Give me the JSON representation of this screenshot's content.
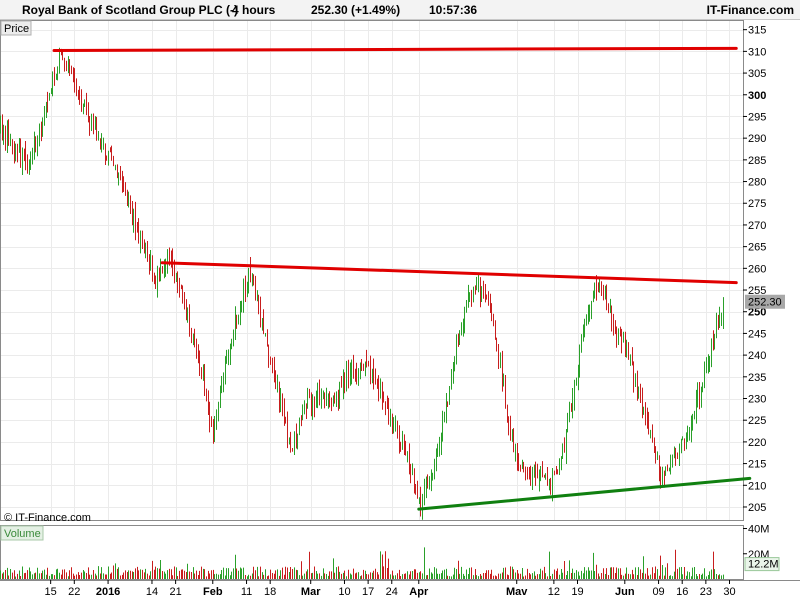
{
  "header": {
    "instrument": "Royal Bank of Scotland Group PLC (-)",
    "interval": "4 hours",
    "price_change": "252.30 (+1.49%)",
    "time": "10:57:36",
    "brand": "IT-Finance.com"
  },
  "panels": {
    "price_label": "Price",
    "volume_label": "Volume",
    "watermark": "© IT-Finance.com"
  },
  "colors": {
    "up": "#2aa02a",
    "down": "#c81e1e",
    "resistance": "#e00000",
    "support": "#108010",
    "last_price_bg": "#a8a8a8",
    "volume_label_bg": "#e4f0e4"
  },
  "chart_data": {
    "type": "candlestick",
    "price_axis": {
      "ylim": [
        202,
        317
      ],
      "ticks": [
        205,
        210,
        215,
        220,
        225,
        230,
        235,
        240,
        245,
        250,
        255,
        260,
        265,
        270,
        275,
        280,
        285,
        290,
        295,
        300,
        305,
        310,
        315
      ],
      "bold_ticks": [
        250,
        300
      ]
    },
    "volume_axis": {
      "ylim": [
        0,
        42
      ],
      "ticks": [
        {
          "value": 40,
          "label": "40M"
        },
        {
          "value": 20,
          "label": "20M"
        }
      ],
      "last_volume": {
        "value": 12.2,
        "label": "12.2M"
      }
    },
    "x_axis": {
      "ticks": [
        {
          "label": "15",
          "t": 15
        },
        {
          "label": "22",
          "t": 22
        },
        {
          "label": "2016",
          "t": 32,
          "bold": true
        },
        {
          "label": "14",
          "t": 45
        },
        {
          "label": "21",
          "t": 52
        },
        {
          "label": "Feb",
          "t": 63,
          "bold": true
        },
        {
          "label": "11",
          "t": 73
        },
        {
          "label": "18",
          "t": 80
        },
        {
          "label": "Mar",
          "t": 92,
          "bold": true
        },
        {
          "label": "10",
          "t": 102
        },
        {
          "label": "17",
          "t": 109
        },
        {
          "label": "24",
          "t": 116
        },
        {
          "label": "Apr",
          "t": 124,
          "bold": true
        },
        {
          "label": "Mav",
          "t": 153,
          "bold": true
        },
        {
          "label": "12",
          "t": 164
        },
        {
          "label": "19",
          "t": 171
        },
        {
          "label": "Jun",
          "t": 185,
          "bold": true
        },
        {
          "label": "09",
          "t": 195
        },
        {
          "label": "16",
          "t": 202
        },
        {
          "label": "23",
          "t": 209
        },
        {
          "label": "30",
          "t": 216
        }
      ],
      "tlim": [
        0,
        220
      ]
    },
    "last_price": {
      "value": 252.3,
      "label": "252.30"
    },
    "anchors": [
      [
        0,
        292
      ],
      [
        8,
        284
      ],
      [
        13,
        295
      ],
      [
        18,
        310
      ],
      [
        22,
        303
      ],
      [
        27,
        293
      ],
      [
        35,
        282
      ],
      [
        41,
        268
      ],
      [
        46,
        257
      ],
      [
        50,
        262
      ],
      [
        55,
        250
      ],
      [
        60,
        235
      ],
      [
        63,
        222
      ],
      [
        66,
        236
      ],
      [
        71,
        252
      ],
      [
        74,
        259
      ],
      [
        78,
        245
      ],
      [
        82,
        232
      ],
      [
        86,
        218
      ],
      [
        90,
        228
      ],
      [
        95,
        231
      ],
      [
        99,
        228
      ],
      [
        103,
        236
      ],
      [
        108,
        238
      ],
      [
        112,
        232
      ],
      [
        116,
        224
      ],
      [
        120,
        218
      ],
      [
        124,
        206
      ],
      [
        128,
        213
      ],
      [
        132,
        228
      ],
      [
        136,
        246
      ],
      [
        140,
        256
      ],
      [
        144,
        252
      ],
      [
        148,
        238
      ],
      [
        151,
        222
      ],
      [
        155,
        212
      ],
      [
        159,
        213
      ],
      [
        163,
        210
      ],
      [
        167,
        220
      ],
      [
        171,
        238
      ],
      [
        175,
        254
      ],
      [
        178,
        256
      ],
      [
        182,
        246
      ],
      [
        186,
        240
      ],
      [
        190,
        227
      ],
      [
        193,
        220
      ],
      [
        196,
        211
      ],
      [
        199,
        216
      ],
      [
        202,
        219
      ],
      [
        205,
        226
      ],
      [
        208,
        234
      ],
      [
        211,
        244
      ],
      [
        214,
        252.3
      ]
    ],
    "trendlines": [
      {
        "kind": "resistance",
        "from": [
          16,
          310.2
        ],
        "to": [
          218,
          310.7
        ]
      },
      {
        "kind": "resistance",
        "from": [
          48,
          261.3
        ],
        "to": [
          218,
          256.7
        ]
      },
      {
        "kind": "support",
        "from": [
          124,
          204.5
        ],
        "to": [
          222,
          211.6
        ]
      }
    ]
  }
}
